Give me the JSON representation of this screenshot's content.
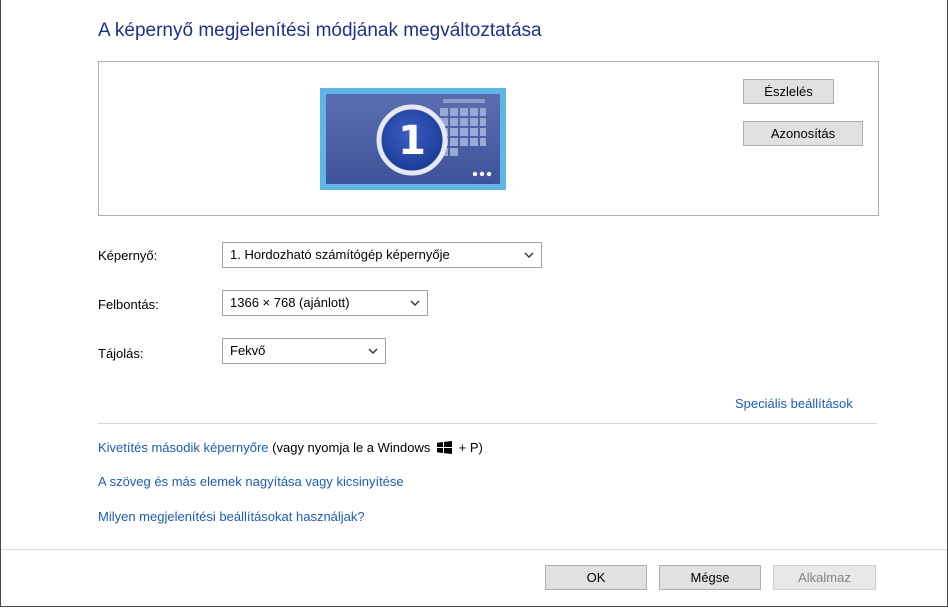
{
  "title": "A képernyő megjelenítési módjának megváltoztatása",
  "preview": {
    "monitor_number": "1",
    "detect_label": "Észlelés",
    "identify_label": "Azonosítás"
  },
  "form": {
    "display_label": "Képernyő:",
    "display_value": "1. Hordozható számítógép képernyője",
    "resolution_label": "Felbontás:",
    "resolution_value": "1366 × 768 (ajánlott)",
    "orientation_label": "Tájolás:",
    "orientation_value": "Fekvő"
  },
  "links": {
    "advanced": "Speciális beállítások",
    "project_link": "Kivetítés második képernyőre",
    "project_hint_prefix": "(vagy nyomja le a Windows",
    "project_hint_suffix": "+ P)",
    "text_size": "A szöveg és más elemek nagyítása vagy kicsinyítése",
    "which_settings": "Milyen megjelenítési beállításokat használjak?"
  },
  "buttons": {
    "ok": "OK",
    "cancel": "Mégse",
    "apply": "Alkalmaz"
  },
  "colors": {
    "title": "#1e3287",
    "link": "#1e5cb3",
    "monitor_screen": "#4d61a3",
    "monitor_frame": "#5fb4e8"
  },
  "icons": {
    "windows_logo": "windows-logo-icon",
    "dropdown": "chevron-down-icon"
  }
}
